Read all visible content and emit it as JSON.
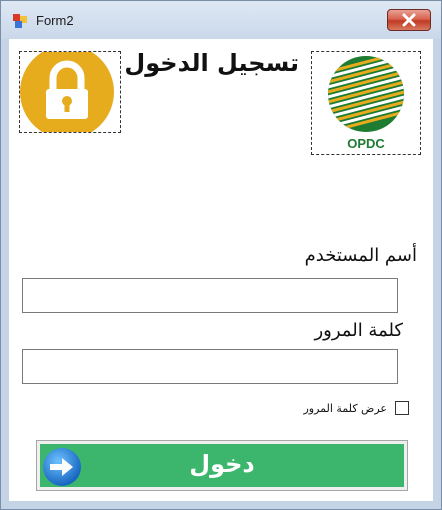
{
  "window": {
    "title": "Form2"
  },
  "colors": {
    "button_green": "#3cb66c",
    "lock_gold": "#e7ac1d",
    "logo_green": "#1e7b32"
  },
  "header": {
    "heading": "تسجيل الدخول",
    "logo_caption": "OPDC"
  },
  "form": {
    "username_label": "أسم المستخدم",
    "username_value": "",
    "password_label": "كلمة المرور",
    "password_value": "",
    "show_password_label": "عرض كلمة المرور",
    "show_password_checked": false,
    "login_label": "دخول"
  },
  "icons": [
    "app-icon",
    "close-icon",
    "lock-icon",
    "logo-icon",
    "arrow-right-icon"
  ]
}
